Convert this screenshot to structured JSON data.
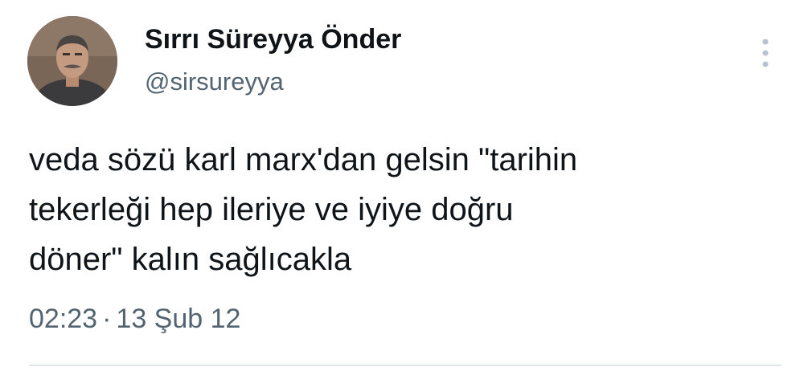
{
  "author": {
    "display_name": "Sırrı Süreyya Önder",
    "handle": "@sirsureyya",
    "avatar_icon": "profile-photo"
  },
  "tweet": {
    "text": "veda sözü karl marx'dan gelsin \"tarihin\ntekerleği hep ileriye ve iyiye doğru\ndöner\" kalın sağlıcakla",
    "time": "02:23",
    "separator": "·",
    "date": "13 Şub 12"
  },
  "menu": {
    "icon": "more-vertical-icon"
  },
  "colors": {
    "text_primary": "#0f1419",
    "text_secondary": "#536471",
    "divider": "#e1e6ea",
    "menu_dots": "#b8c4cd"
  }
}
